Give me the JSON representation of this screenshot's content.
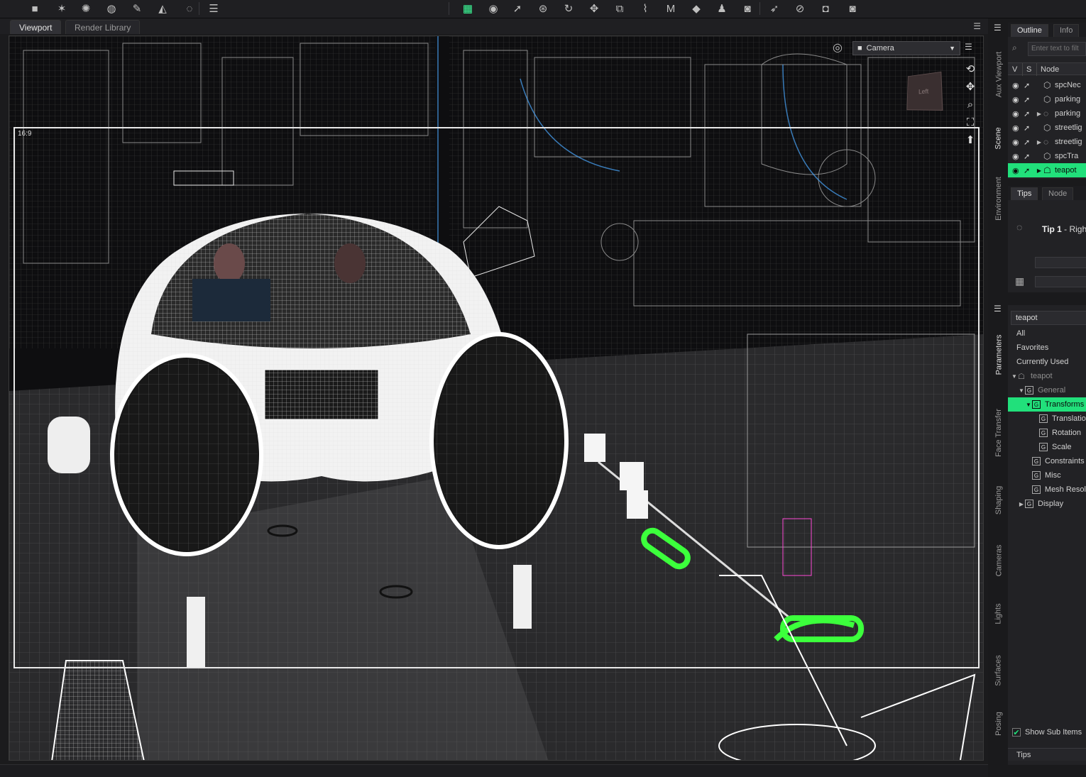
{
  "toolbar": {
    "icons": [
      "camera-icon",
      "light-icon",
      "spot-light-icon",
      "spotlight-icon",
      "wand-icon",
      "paint-bucket-icon",
      "geometry-icon",
      "align-icon",
      "grid-view-icon",
      "sphere-icon",
      "pointer-icon",
      "universal-tool-icon",
      "rotate-icon",
      "move-icon",
      "scale-icon",
      "joint-editor-icon",
      "morph-icon",
      "geometry-editor-icon",
      "figure-icon",
      "render-icon",
      "pose-pointer-icon",
      "node-weight-icon",
      "screenshot-icon",
      "render-camera-icon"
    ]
  },
  "viewport_tabs": [
    "Viewport",
    "Render Library"
  ],
  "viewport": {
    "aspect_label": "16:9",
    "camera_select": "Camera"
  },
  "left_side_tabs": [
    "Aux Viewport",
    "Scene",
    "Environment"
  ],
  "right_side_tabs": [
    "Parameters",
    "Face Transfer",
    "Shaping",
    "Cameras",
    "Lights",
    "Surfaces",
    "Posing"
  ],
  "scene_pane": {
    "tabs": [
      "Outline",
      "Info"
    ],
    "filter_placeholder": "Enter text to filt",
    "columns": {
      "v": "V",
      "s": "S",
      "node": "Node"
    },
    "nodes": [
      {
        "name": "spcNec",
        "expandable": false,
        "selected": false,
        "icon": "prop-icon"
      },
      {
        "name": "parking",
        "expandable": false,
        "selected": false,
        "icon": "prop-icon"
      },
      {
        "name": "parking",
        "expandable": true,
        "selected": false,
        "icon": "group-icon"
      },
      {
        "name": "streetlig",
        "expandable": false,
        "selected": false,
        "icon": "prop-icon"
      },
      {
        "name": "streetlig",
        "expandable": true,
        "selected": false,
        "icon": "group-icon"
      },
      {
        "name": "spcTra",
        "expandable": false,
        "selected": false,
        "icon": "prop-icon"
      },
      {
        "name": "teapot",
        "expandable": true,
        "selected": true,
        "icon": "teapot-icon"
      }
    ]
  },
  "tips_pane": {
    "tabs": [
      "Tips",
      "Node"
    ],
    "tip_title": "Tip 1",
    "tip_text": " - Righ"
  },
  "parameters_pane": {
    "search_value": "teapot",
    "filters": [
      "All",
      "Favorites",
      "Currently Used"
    ],
    "tree": [
      {
        "label": "teapot",
        "indent": 0,
        "expanded": true,
        "icon": "teapot-icon",
        "dim": true,
        "highlight": false
      },
      {
        "label": "General",
        "indent": 1,
        "expanded": true,
        "icon": "group",
        "dim": true,
        "highlight": false
      },
      {
        "label": "Transforms",
        "indent": 2,
        "expanded": true,
        "icon": "group",
        "dim": false,
        "highlight": true
      },
      {
        "label": "Translatio",
        "indent": 3,
        "expanded": null,
        "icon": "group",
        "dim": false,
        "highlight": false
      },
      {
        "label": "Rotation",
        "indent": 3,
        "expanded": null,
        "icon": "group",
        "dim": false,
        "highlight": false
      },
      {
        "label": "Scale",
        "indent": 3,
        "expanded": null,
        "icon": "group",
        "dim": false,
        "highlight": false
      },
      {
        "label": "Constraints",
        "indent": 2,
        "expanded": null,
        "icon": "group",
        "dim": false,
        "highlight": false
      },
      {
        "label": "Misc",
        "indent": 2,
        "expanded": null,
        "icon": "group",
        "dim": false,
        "highlight": false
      },
      {
        "label": "Mesh Resol",
        "indent": 2,
        "expanded": null,
        "icon": "group",
        "dim": false,
        "highlight": false
      },
      {
        "label": "Display",
        "indent": 1,
        "expanded": false,
        "icon": "group",
        "dim": false,
        "highlight": false
      }
    ],
    "show_sub_items": "Show Sub Items",
    "show_sub_items_checked": true,
    "bottom_tab": "Tips"
  },
  "colors": {
    "accent": "#21e07b",
    "background": "#1b1b1d"
  }
}
